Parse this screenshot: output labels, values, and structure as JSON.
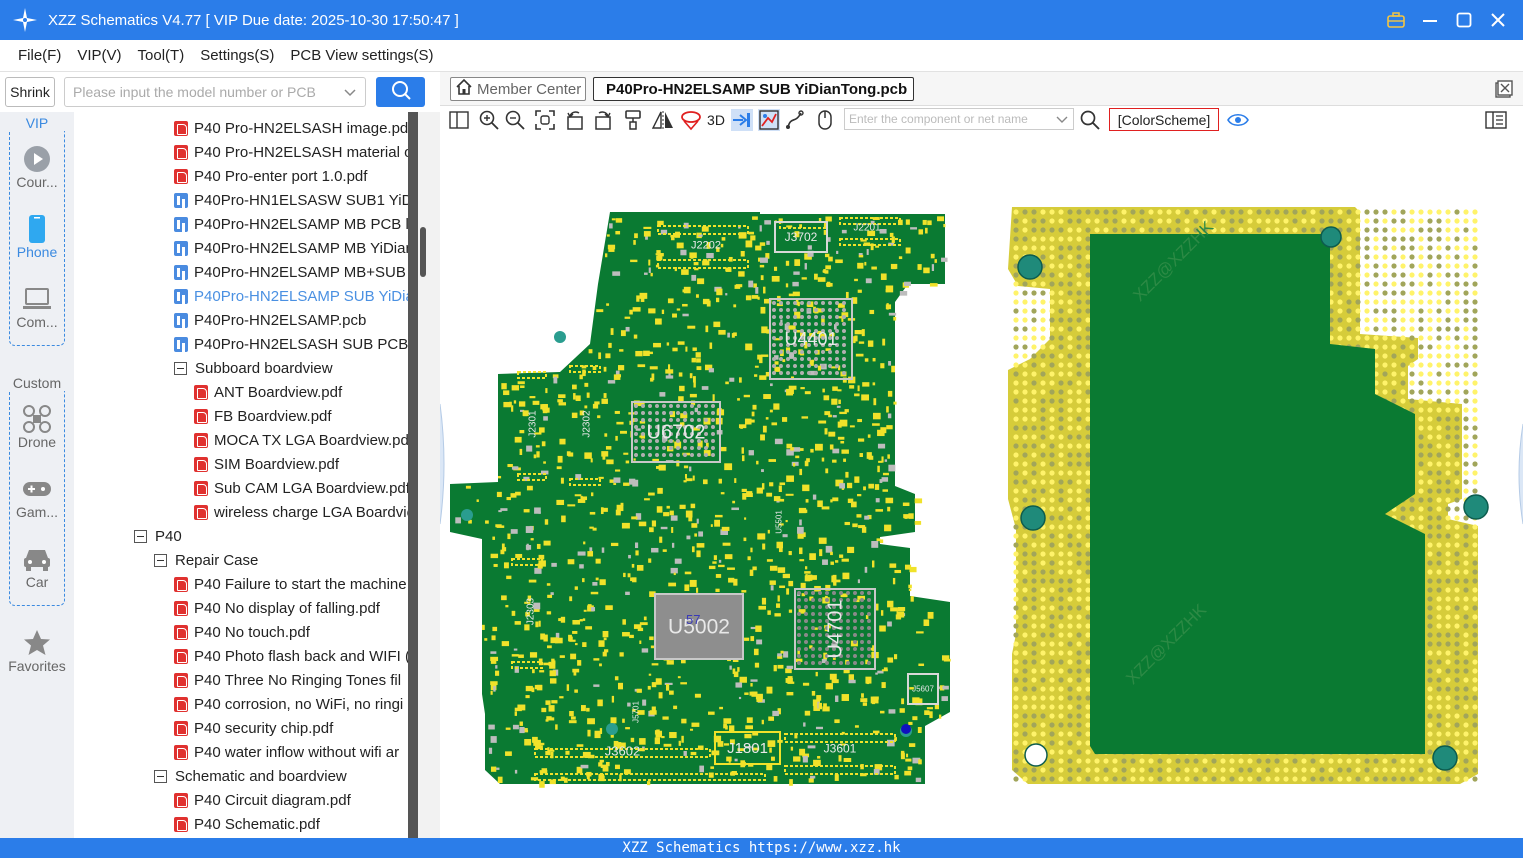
{
  "window": {
    "title": "XZZ Schematics V4.77 [ VIP Due date: 2025-10-30 17:50:47 ]"
  },
  "menu": [
    "File(F)",
    "VIP(V)",
    "Tool(T)",
    "Settings(S)",
    "PCB View settings(S)"
  ],
  "search": {
    "shrink_label": "Shrink",
    "placeholder": "Please input the model number or PCB"
  },
  "left_nav": {
    "vip_group_label": "VIP",
    "vip_items": [
      "Cour...",
      "Phone",
      "Com..."
    ],
    "custom_group_label": "Custom",
    "custom_items": [
      "Drone",
      "Gam...",
      "Car"
    ],
    "favorites": "Favorites"
  },
  "tree": [
    {
      "label": "P40 Pro-HN2ELSASH image.pdf",
      "type": "pdf",
      "level": 3
    },
    {
      "label": "P40 Pro-HN2ELSASH material o",
      "type": "pdf",
      "level": 3
    },
    {
      "label": "P40 Pro-enter port 1.0.pdf",
      "type": "pdf",
      "level": 3
    },
    {
      "label": "P40Pro-HN1ELSASW SUB1 YiDi",
      "type": "pcb",
      "level": 3
    },
    {
      "label": "P40Pro-HN2ELSAMP MB PCB la",
      "type": "pcb",
      "level": 3
    },
    {
      "label": "P40Pro-HN2ELSAMP MB YiDian",
      "type": "pcb",
      "level": 3
    },
    {
      "label": "P40Pro-HN2ELSAMP MB+SUB I",
      "type": "pcb",
      "level": 3
    },
    {
      "label": "P40Pro-HN2ELSAMP SUB YiDia",
      "type": "pcb",
      "level": 3,
      "selected": true
    },
    {
      "label": "P40Pro-HN2ELSAMP.pcb",
      "type": "pcb",
      "level": 3
    },
    {
      "label": "P40Pro-HN2ELSASH SUB PCB la",
      "type": "pcb",
      "level": 3
    },
    {
      "label": "Subboard boardview",
      "type": "folder",
      "level": 3
    },
    {
      "label": "ANT Boardview.pdf",
      "type": "pdf",
      "level": 4
    },
    {
      "label": "FB Boardview.pdf",
      "type": "pdf",
      "level": 4
    },
    {
      "label": "MOCA TX LGA Boardview.pd",
      "type": "pdf",
      "level": 4
    },
    {
      "label": "SIM Boardview.pdf",
      "type": "pdf",
      "level": 4
    },
    {
      "label": "Sub CAM LGA Boardview.pdf",
      "type": "pdf",
      "level": 4
    },
    {
      "label": "wireless charge LGA Boardvie",
      "type": "pdf",
      "level": 4
    },
    {
      "label": "P40",
      "type": "folder",
      "level": 1
    },
    {
      "label": "Repair Case",
      "type": "folder",
      "level": 2
    },
    {
      "label": "P40 Failure to start the machine",
      "type": "pdf",
      "level": 3
    },
    {
      "label": "P40 No display of falling.pdf",
      "type": "pdf",
      "level": 3
    },
    {
      "label": "P40 No touch.pdf",
      "type": "pdf",
      "level": 3
    },
    {
      "label": "P40 Photo flash back and WIFI (",
      "type": "pdf",
      "level": 3
    },
    {
      "label": "P40 Three No Ringing Tones fil",
      "type": "pdf",
      "level": 3
    },
    {
      "label": "P40 corrosion, no WiFi, no ringi",
      "type": "pdf",
      "level": 3
    },
    {
      "label": "P40 security chip.pdf",
      "type": "pdf",
      "level": 3
    },
    {
      "label": "P40 water inflow without wifi ar",
      "type": "pdf",
      "level": 3
    },
    {
      "label": "Schematic and boardview",
      "type": "folder",
      "level": 2
    },
    {
      "label": "P40 Circuit diagram.pdf",
      "type": "pdf",
      "level": 3
    },
    {
      "label": "P40 Schematic.pdf",
      "type": "pdf",
      "level": 3
    }
  ],
  "tabs": {
    "member_center": "Member Center",
    "active_file": "P40Pro-HN2ELSAMP SUB YiDianTong.pcb"
  },
  "toolbar": {
    "label_3d": "3D",
    "component_placeholder": "Enter the component or net name",
    "color_scheme": "[ColorScheme]"
  },
  "pcb": {
    "components": [
      "U4401",
      "U6702",
      "U5002",
      "U4701",
      "J1801",
      "J3602",
      "J3601",
      "J3702",
      "J2202",
      "J2201",
      "J2301",
      "J2302",
      "J2303",
      "J5607",
      "J5701",
      "U5501"
    ],
    "net_label": "57",
    "watermarks": [
      "XZZ@XZZHK",
      "XZZ@XZZHK"
    ]
  },
  "status_bar": "XZZ Schematics https://www.xzz.hk",
  "colors": {
    "accent": "#2b7de9",
    "board_green": "#0a7a32",
    "pad_yellow": "#f0e22a",
    "selected_item": "#4a90e2"
  }
}
